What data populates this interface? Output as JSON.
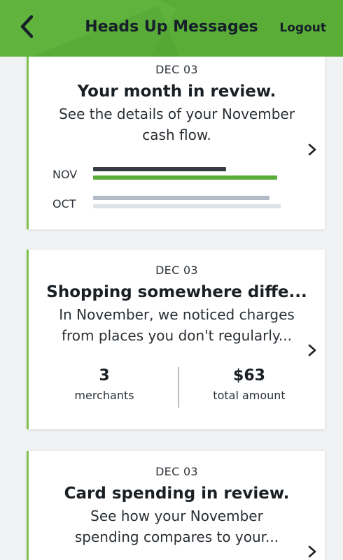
{
  "header": {
    "title": "Heads Up Messages",
    "logout_label": "Logout",
    "back_icon": "chevron-left-icon",
    "bg_color": "#5aae38"
  },
  "cards": [
    {
      "date": "DEC 03",
      "title": "Your month in review.",
      "body_lines": [
        "See the details of your November",
        "cash flow."
      ],
      "bars": [
        {
          "label": "NOV",
          "spend_fraction": 0.7,
          "income_fraction": 0.97
        },
        {
          "label": "OCT",
          "spend_fraction": 0.93,
          "income_fraction": 0.99
        }
      ],
      "colors": {
        "nov_spend": "#363d45",
        "nov_income": "#5aae38",
        "oct_spend": "#b3bcc6",
        "oct_income": "#dfe3e7"
      }
    },
    {
      "date": "DEC 03",
      "title": "Shopping somewhere diffe...",
      "body_lines": [
        "In November, we noticed charges",
        "from places you don't regularly..."
      ],
      "stats": [
        {
          "value": "3",
          "label": "merchants"
        },
        {
          "value": "$63",
          "label": "total amount"
        }
      ]
    },
    {
      "date": "DEC 03",
      "title": "Card spending in review.",
      "body_lines": [
        "See how your November",
        "spending compares to your..."
      ]
    }
  ],
  "accent_color": "#7dc24e"
}
